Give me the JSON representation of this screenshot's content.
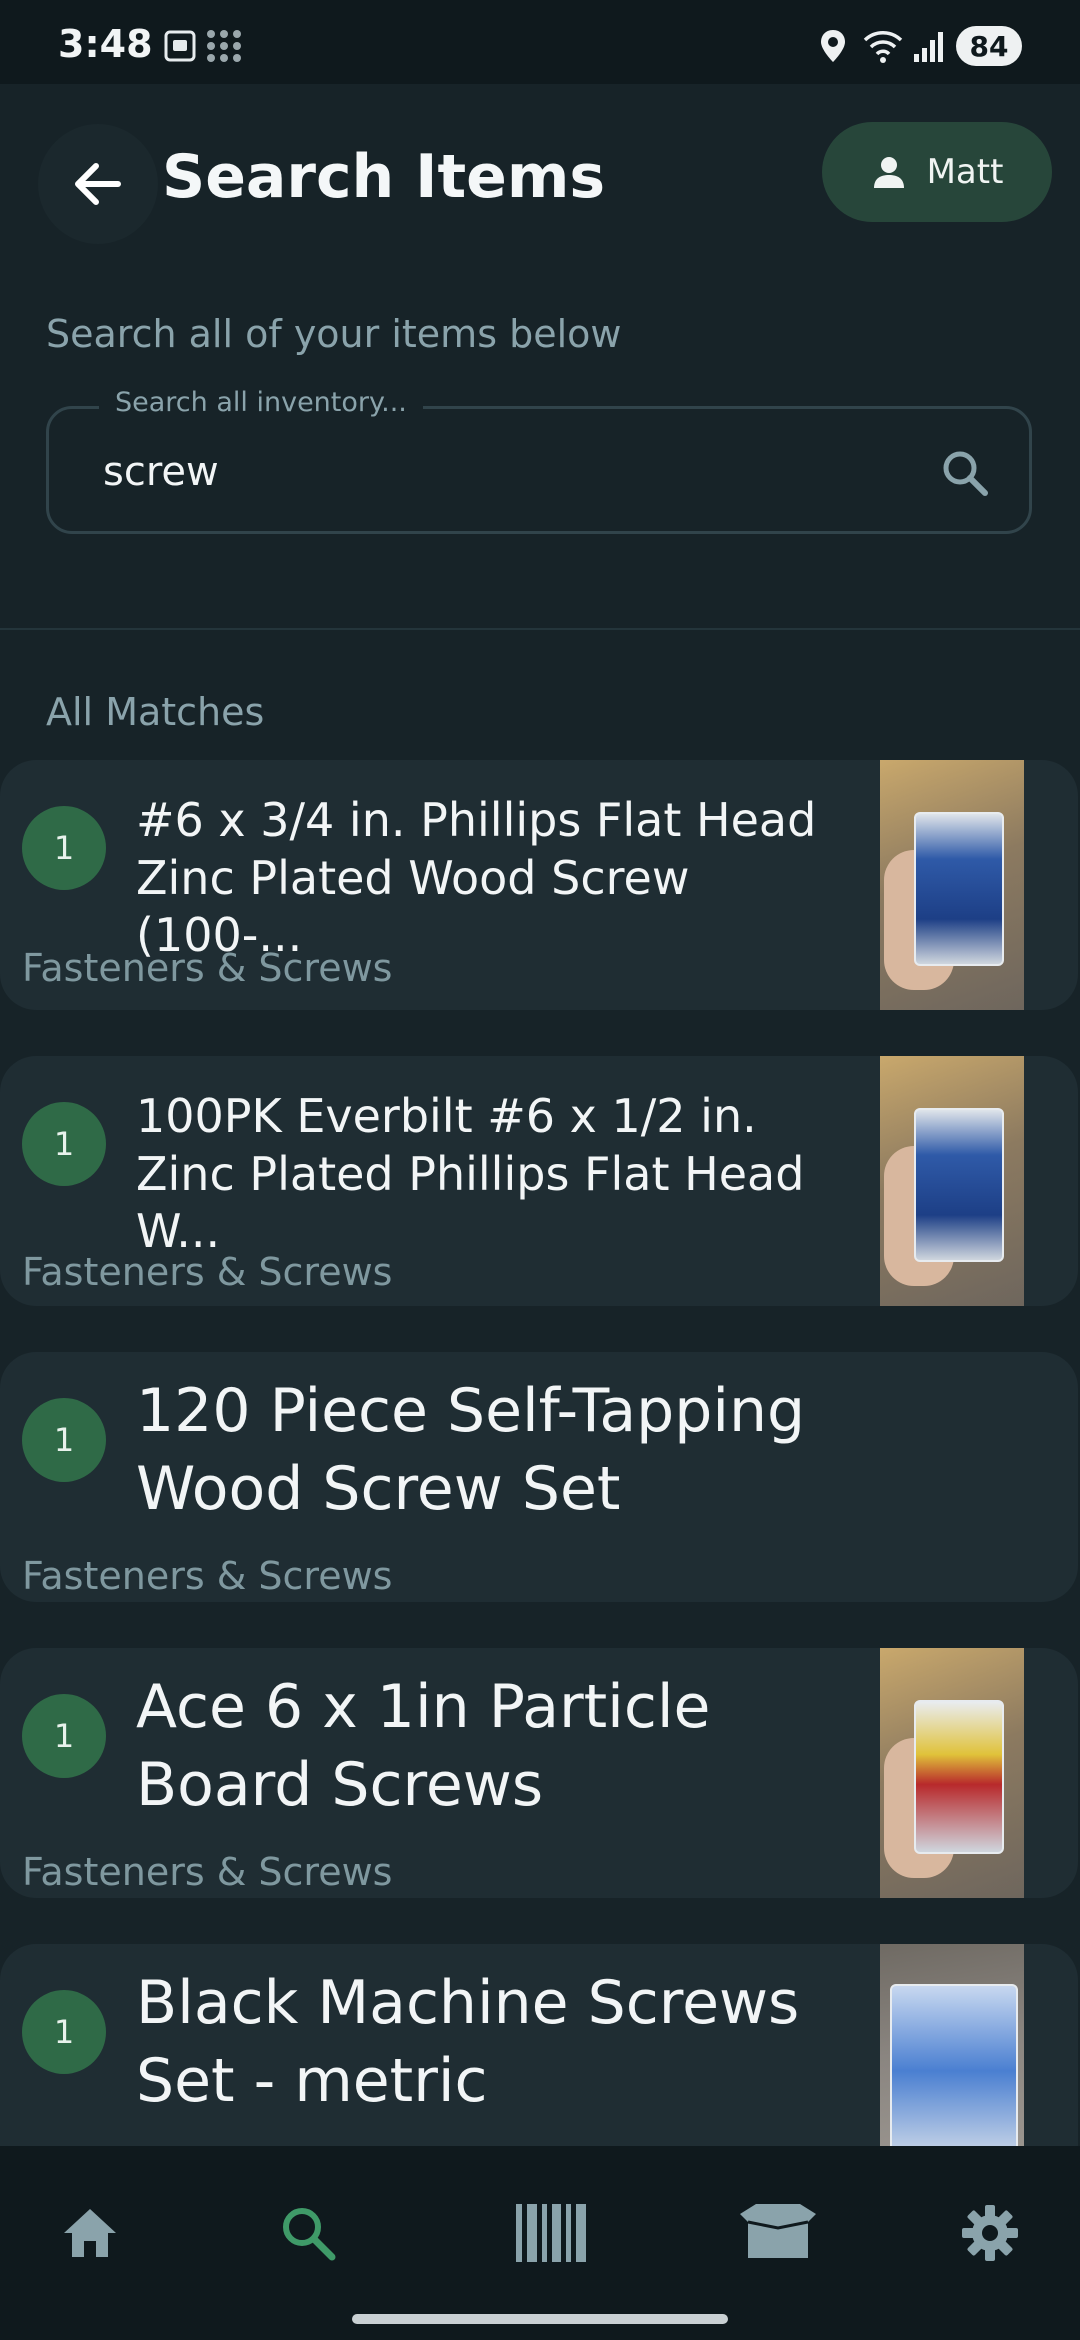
{
  "status_bar": {
    "time": "3:48",
    "battery": "84",
    "icons": [
      "screenshot-icon",
      "apps-grid-icon",
      "location-icon",
      "wifi-icon",
      "signal-icon"
    ]
  },
  "app_bar": {
    "title": "Search Items",
    "user_name": "Matt"
  },
  "search": {
    "subtitle": "Search all of your items below",
    "label": "Search all inventory...",
    "value": "screw"
  },
  "results": {
    "section_label": "All Matches",
    "items": [
      {
        "qty": "1",
        "name": "#6 x 3/4 in. Phillips Flat Head Zinc Plated Wood Screw (100-...",
        "category": "Fasteners & Screws",
        "has_image": true
      },
      {
        "qty": "1",
        "name": "100PK Everbilt #6 x 1/2 in. Zinc Plated Phillips Flat Head W...",
        "category": "Fasteners & Screws",
        "has_image": true
      },
      {
        "qty": "1",
        "name": "120 Piece Self-Tapping Wood Screw Set",
        "category": "Fasteners & Screws",
        "has_image": false
      },
      {
        "qty": "1",
        "name": "Ace 6 x 1in Particle Board Screws",
        "category": "Fasteners & Screws",
        "has_image": true
      },
      {
        "qty": "1",
        "name": "Black Machine Screws Set - metric",
        "category": "",
        "has_image": true
      }
    ]
  },
  "bottom_nav": {
    "items": [
      "home-icon",
      "search-icon",
      "barcode-icon",
      "box-icon",
      "settings-icon"
    ],
    "active": "search-icon"
  },
  "colors": {
    "background": "#172328",
    "accent": "#2f6a47",
    "active_nav": "#3f9a68"
  }
}
